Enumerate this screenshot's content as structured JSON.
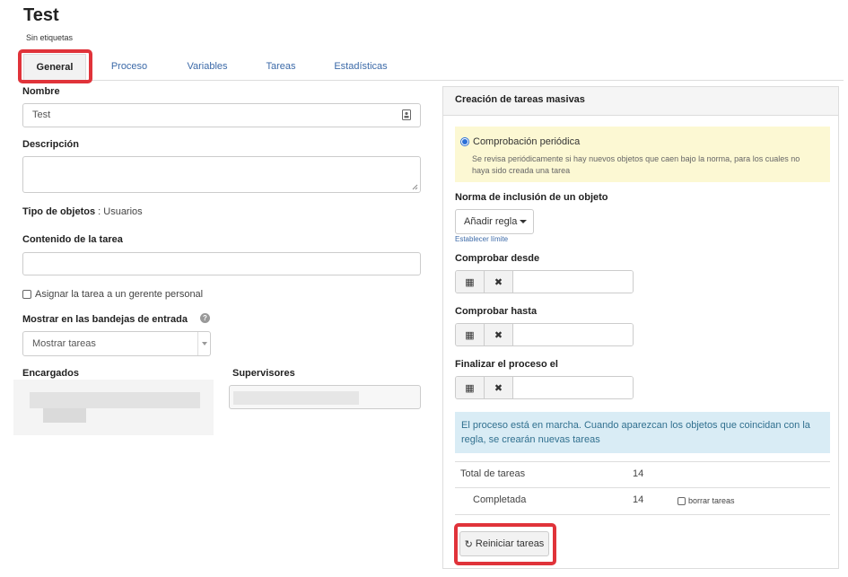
{
  "page": {
    "title": "Test",
    "tagline": "Sin etiquetas"
  },
  "tabs": [
    {
      "label": "General",
      "active": true
    },
    {
      "label": "Proceso",
      "active": false
    },
    {
      "label": "Variables",
      "active": false
    },
    {
      "label": "Tareas",
      "active": false
    },
    {
      "label": "Estadísticas",
      "active": false
    }
  ],
  "form": {
    "name_label": "Nombre",
    "name_value": "Test",
    "description_label": "Descripción",
    "description_value": "",
    "object_type_label": "Tipo de objetos",
    "object_type_value": ": Usuarios",
    "task_content_label": "Contenido de la tarea",
    "task_content_value": "",
    "assign_manager_label": "Asignar la tarea a un gerente personal",
    "assign_manager_checked": false,
    "inbox_label": "Mostrar en las bandejas de entrada",
    "inbox_value": "Mostrar tareas",
    "assignees_label": "Encargados",
    "supervisors_label": "Supervisores"
  },
  "panel": {
    "title": "Creación de tareas masivas",
    "periodic_label": "Comprobación periódica",
    "periodic_checked": true,
    "periodic_desc_line1": "Se revisa periódicamente si hay nuevos objetos que caen bajo la norma, para los cuales no",
    "periodic_desc_line2": "haya sido creada una tarea",
    "inclusion_label": "Norma de inclusión de un objeto",
    "add_rule_label": "Añadir regla",
    "set_limit_label": "Establecer límite",
    "check_from_label": "Comprobar desde",
    "check_to_label": "Comprobar hasta",
    "finish_label": "Finalizar el proceso el",
    "info_line1": "El proceso está en marcha. Cuando aparezcan los objetos que coincidan con la",
    "info_line2": "regla, se crearán nuevas tareas",
    "total_label": "Total de tareas",
    "total_value": "14",
    "completed_label": "Completada",
    "completed_value": "14",
    "delete_tasks_label": "borrar tareas",
    "delete_tasks_checked": false,
    "restart_label": "Reiniciar tareas"
  },
  "colors": {
    "highlight": "#e0333a",
    "link": "#3c6aa8",
    "info_bg": "#d9ecf5",
    "notice_bg": "#fcf8d3"
  }
}
